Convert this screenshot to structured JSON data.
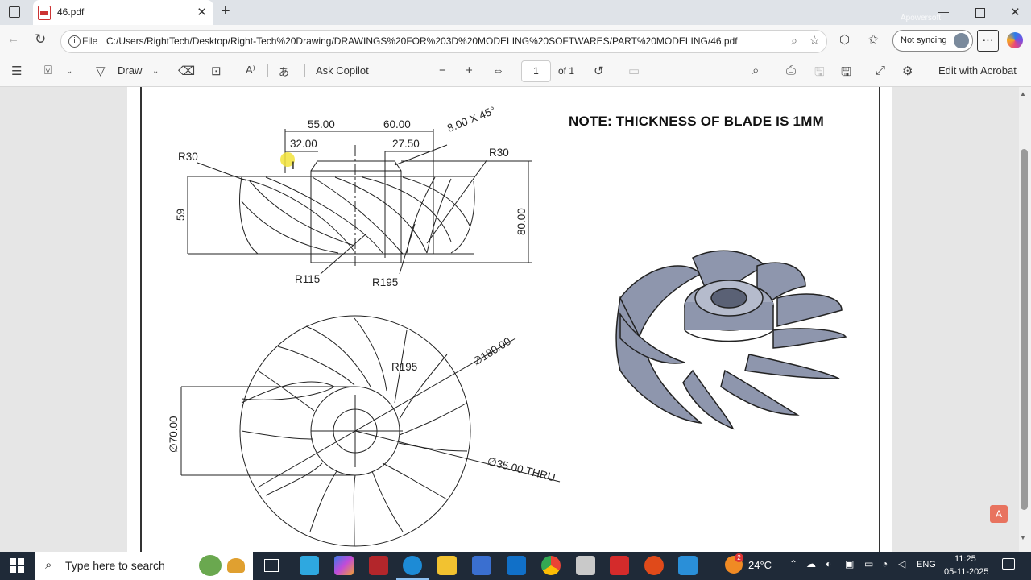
{
  "browser": {
    "tab_title": "46.pdf",
    "new_tab_label": "+",
    "address_prefix": "File",
    "address_url": "C:/Users/RightTech/Desktop/Right-Tech%20Drawing/DRAWINGS%20FOR%203D%20MODELING%20SOFTWARES/PART%20MODELING/46.pdf",
    "sync_label": "Not syncing",
    "watermark": "Apowersoft"
  },
  "pdf_toolbar": {
    "draw_label": "Draw",
    "ask_copilot_label": "Ask Copilot",
    "page_number": "1",
    "page_total": "of 1",
    "edit_acrobat_label": "Edit with Acrobat"
  },
  "drawing": {
    "note": "NOTE: THICKNESS OF BLADE IS 1MM",
    "dims": {
      "d55": "55.00",
      "d60": "60.00",
      "d32": "32.00",
      "d27": "27.50",
      "chamfer": "8.00 X 45°",
      "r30_left": "R30",
      "r30_right": "R30",
      "h59": "59",
      "h80": "80.00",
      "r115": "R115",
      "r195_top": "R195",
      "r195_bottom": "R195",
      "dia180": "∅180.00",
      "dia70": "∅70.00",
      "dia35": "∅35.00 THRU"
    }
  },
  "taskbar": {
    "search_placeholder": "Type here to search",
    "temperature": "24°C",
    "language": "ENG",
    "time": "11:25",
    "date": "05-11-2025",
    "notification_count": "2"
  }
}
